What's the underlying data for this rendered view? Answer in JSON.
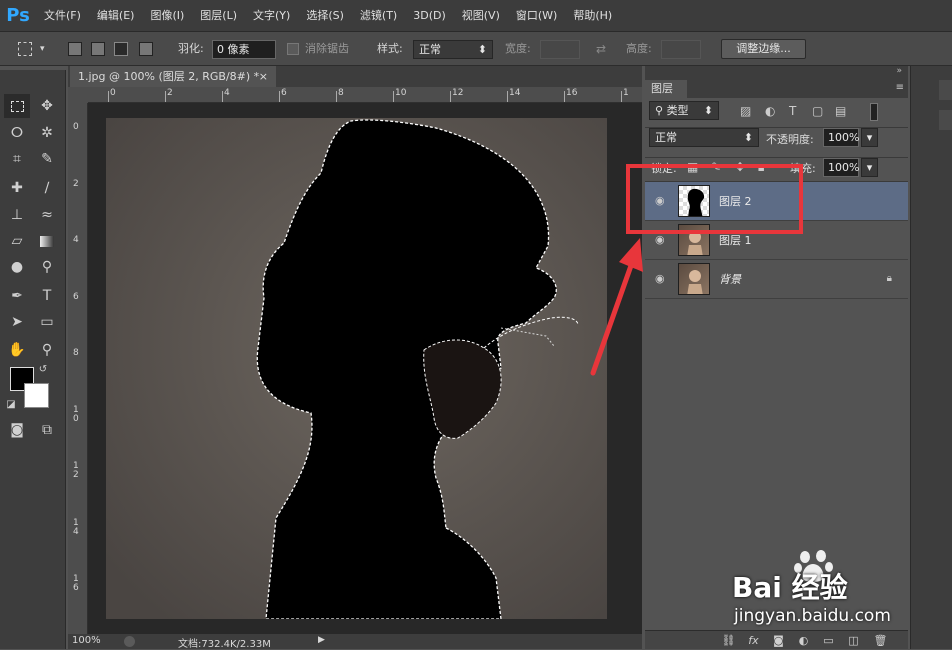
{
  "app": {
    "logo": "Ps"
  },
  "menu": [
    "文件(F)",
    "编辑(E)",
    "图像(I)",
    "图层(L)",
    "文字(Y)",
    "选择(S)",
    "滤镜(T)",
    "3D(D)",
    "视图(V)",
    "窗口(W)",
    "帮助(H)"
  ],
  "options": {
    "feather_label": "羽化:",
    "feather_value": "0 像素",
    "antialias_label": "消除锯齿",
    "style_label": "样式:",
    "style_value": "正常",
    "width_label": "宽度:",
    "height_label": "高度:",
    "refine_edge_button": "调整边缘..."
  },
  "document": {
    "tab_title": "1.jpg @ 100% (图层 2, RGB/8#) *",
    "close_symbol": "×",
    "ruler_top": [
      "0",
      "2",
      "4",
      "6",
      "8",
      "10",
      "12",
      "14",
      "16",
      "1"
    ],
    "ruler_left": [
      "0",
      "2",
      "4",
      "6",
      "8",
      "1\n0",
      "1\n2",
      "1\n4",
      "1\n6"
    ]
  },
  "status": {
    "zoom": "100%",
    "doc_info": "文档:732.4K/2.33M"
  },
  "layers_panel": {
    "title": "图层",
    "filter_type": "类型",
    "blend_mode": "正常",
    "opacity_label": "不透明度:",
    "opacity_value": "100%",
    "lock_label": "锁定:",
    "fill_label": "填充:",
    "fill_value": "100%",
    "layers": [
      {
        "name": "图层 2",
        "selected": true
      },
      {
        "name": "图层 1",
        "selected": false
      },
      {
        "name": "背景",
        "selected": false,
        "locked": true
      }
    ],
    "bottom_icons": [
      "link-icon",
      "fx-icon",
      "mask-icon",
      "adjustment-icon",
      "group-icon",
      "new-layer-icon",
      "trash-icon"
    ],
    "fx_label": "fx"
  },
  "annotation": {
    "color": "#e8363b"
  },
  "watermark": {
    "brand": "Bai 经验",
    "url": "jingyan.baidu.com"
  },
  "colors": {
    "app_bg": "#535353",
    "selected_layer": "#5d6c86",
    "accent": "#31a8ff"
  }
}
